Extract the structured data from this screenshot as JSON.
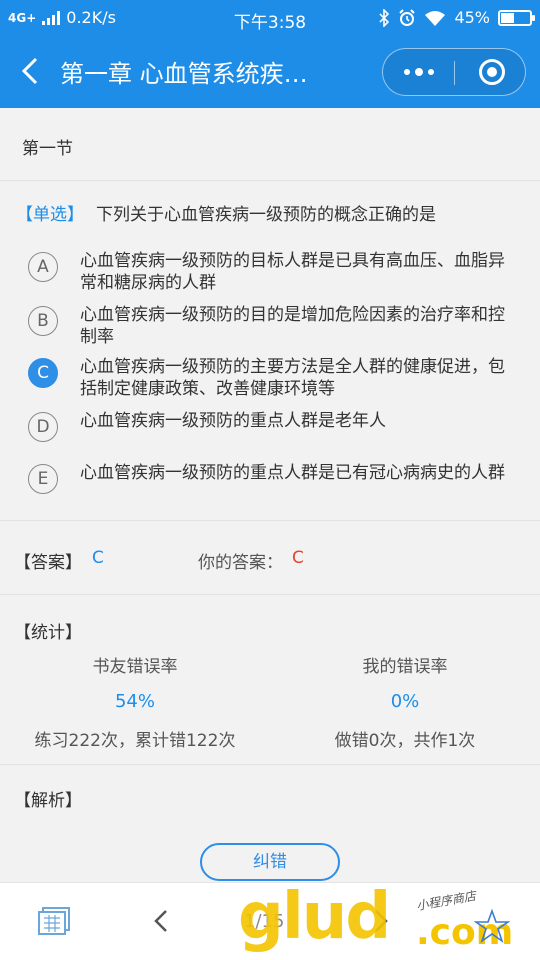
{
  "status_bar": {
    "network": "4G+",
    "speed": "0.2K/s",
    "time": "下午3:58",
    "battery": "45%",
    "battery_level": 0.45
  },
  "nav": {
    "title": "第一章 心血管系统疾…"
  },
  "section": {
    "title": "第一节"
  },
  "question": {
    "type_label": "【单选】",
    "text": "下列关于心血管疾病一级预防的概念正确的是",
    "options": [
      {
        "letter": "A",
        "text": "心血管疾病一级预防的目标人群是已具有高血压、血脂异常和糖尿病的人群",
        "selected": false
      },
      {
        "letter": "B",
        "text": "心血管疾病一级预防的目的是增加危险因素的治疗率和控制率",
        "selected": false
      },
      {
        "letter": "C",
        "text": "心血管疾病一级预防的主要方法是全人群的健康促进，包括制定健康政策、改善健康环境等",
        "selected": true
      },
      {
        "letter": "D",
        "text": "心血管疾病一级预防的重点人群是老年人",
        "selected": false
      },
      {
        "letter": "E",
        "text": "心血管疾病一级预防的重点人群是已有冠心病病史的人群",
        "selected": false
      }
    ]
  },
  "answer": {
    "label": "【答案】",
    "value": "C",
    "your_label": "你的答案：",
    "your_value": "C"
  },
  "stats": {
    "title": "【统计】",
    "friends": {
      "heading": "书友错误率",
      "rate": "54%",
      "detail": "练习222次，累计错122次"
    },
    "mine": {
      "heading": "我的错误率",
      "rate": "0%",
      "detail": "做错0次，共作1次"
    }
  },
  "analysis": {
    "title": "【解析】",
    "report_button": "纠错"
  },
  "bottom": {
    "page_indicator": "1/15"
  },
  "watermark": {
    "big": "glud",
    "com": ".com",
    "small": "小程序商店"
  },
  "colors": {
    "primary": "#1e8de8",
    "your_answer": "#e0462c",
    "watermark": "#f5c400"
  }
}
